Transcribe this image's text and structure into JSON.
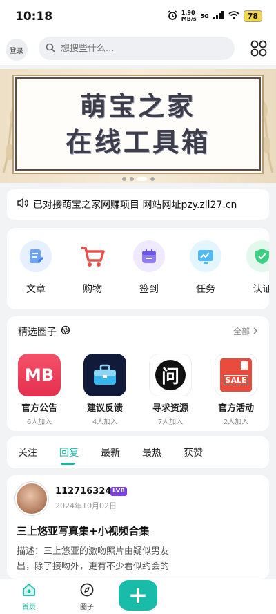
{
  "status": {
    "time": "10:18",
    "speed_value": "1.90",
    "speed_unit": "MB/s",
    "network": "5G",
    "battery": "78"
  },
  "header": {
    "login_label": "登录",
    "search_placeholder": "想搜些什么..."
  },
  "banner": {
    "line1": "萌宝之家",
    "line2": "在线工具箱"
  },
  "notice": {
    "text": "已对接萌宝之家网赚项目 网站网址pzy.zll27.cn"
  },
  "quick_actions": [
    {
      "label": "文章",
      "icon": "article-icon"
    },
    {
      "label": "购物",
      "icon": "cart-icon"
    },
    {
      "label": "签到",
      "icon": "calendar-icon"
    },
    {
      "label": "任务",
      "icon": "task-chart-icon"
    },
    {
      "label": "认证",
      "icon": "verify-shield-icon"
    }
  ],
  "circles": {
    "title": "精选圈子",
    "all_label": "全部",
    "items": [
      {
        "name": "官方公告",
        "count": "6人加入",
        "logo_text": "MB"
      },
      {
        "name": "建议反馈",
        "count": "4人加入",
        "logo_text": ""
      },
      {
        "name": "寻求资源",
        "count": "7人加入",
        "logo_text": "问"
      },
      {
        "name": "官方活动",
        "count": "2人加入",
        "logo_text": "SALE"
      }
    ]
  },
  "feed_tabs": [
    {
      "label": "关注",
      "active": false
    },
    {
      "label": "回复",
      "active": true
    },
    {
      "label": "最新",
      "active": false
    },
    {
      "label": "最热",
      "active": false
    },
    {
      "label": "获赞",
      "active": false
    }
  ],
  "post": {
    "username": "1127163244",
    "level": "LV8",
    "date": "2024年10月02日",
    "title": "三上悠亚写真集+小视频合集",
    "desc": "描述：三上悠亚的激吻照片由疑似男友",
    "desc2": "出，除了接吻外，更有不少看似约会的"
  },
  "bottom_nav": [
    {
      "label": "首页",
      "active": true
    },
    {
      "label": "圈子",
      "active": false
    }
  ],
  "colors": {
    "accent": "#17b8a6"
  }
}
